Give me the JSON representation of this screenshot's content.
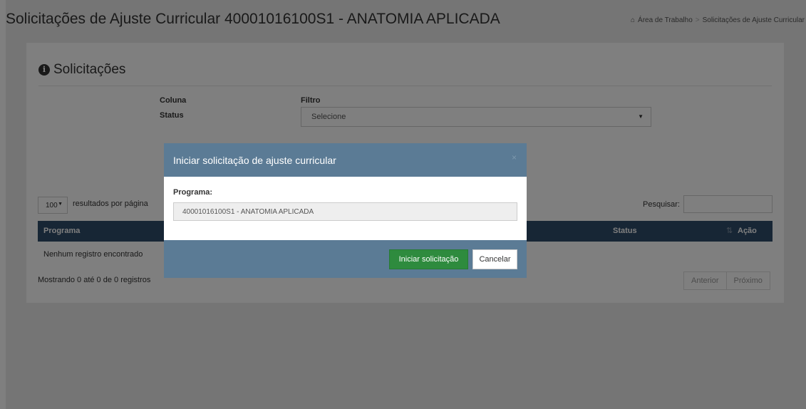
{
  "header": {
    "title": "Solicitações de Ajuste Curricular 40001016100S1 - ANATOMIA APLICADA",
    "breadcrumb": [
      "Área de Trabalho",
      "Solicitações de Ajuste Curricular"
    ],
    "breadcrumb_separator": ">"
  },
  "panel": {
    "title": "Solicitações",
    "filter": {
      "column_header": "Coluna",
      "column_value": "Status",
      "filter_header": "Filtro",
      "filter_value": "Selecione"
    },
    "table": {
      "length_value": "100",
      "length_label": "resultados por página",
      "search_label": "Pesquisar:",
      "search_value": "",
      "columns": [
        "Programa",
        "Status",
        "Ação"
      ],
      "sort_glyph": "⇅",
      "empty_message": "Nenhum registro encontrado",
      "info": "Mostrando 0 até 0 de 0 registros",
      "pager": {
        "previous": "Anterior",
        "next": "Próximo"
      }
    }
  },
  "modal": {
    "title": "Iniciar solicitação de ajuste curricular",
    "close_glyph": "×",
    "field_label": "Programa:",
    "field_value": "40001016100S1 - ANATOMIA APLICADA",
    "primary_button": "Iniciar solicitação",
    "cancel_button": "Cancelar"
  },
  "colors": {
    "table_header": "#2f4c6a",
    "modal_header": "#5b7b95",
    "primary_button": "#2e8b3e"
  },
  "icons": {
    "home": "home-icon",
    "info": "info-circle-icon",
    "caret": "caret-down-icon",
    "sort": "sort-icon",
    "close": "close-icon"
  }
}
